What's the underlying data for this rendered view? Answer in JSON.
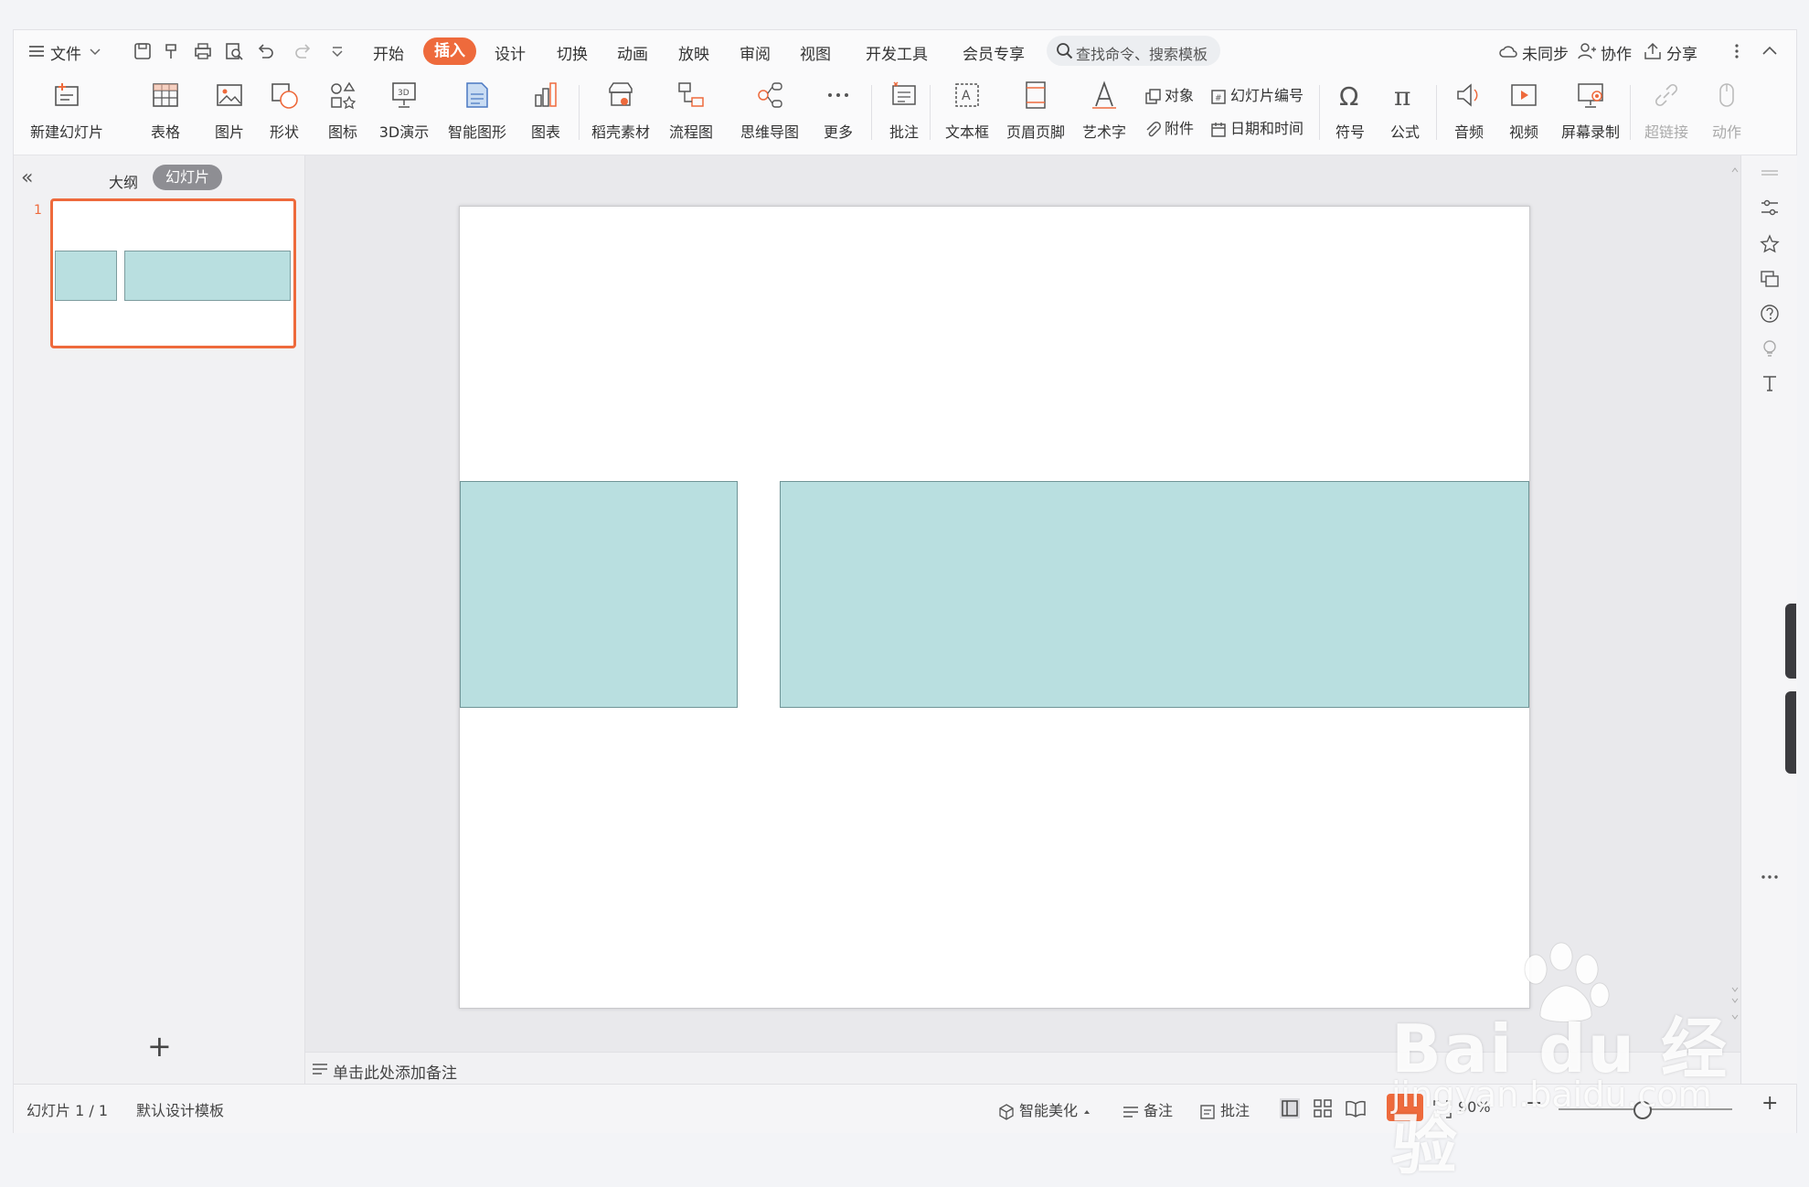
{
  "menubar": {
    "file_label": "文件",
    "tabs": [
      "开始",
      "插入",
      "设计",
      "切换",
      "动画",
      "放映",
      "审阅",
      "视图",
      "开发工具",
      "会员专享"
    ],
    "search_placeholder": "查找命令、搜索模板",
    "sync_label": "未同步",
    "collab_label": "协作",
    "share_label": "分享"
  },
  "ribbon": {
    "new_slide": "新建幻灯片",
    "table": "表格",
    "picture": "图片",
    "shape": "形状",
    "icon": "图标",
    "demo3d": "3D演示",
    "smartart": "智能图形",
    "chart": "图表",
    "material": "稻壳素材",
    "flowchart": "流程图",
    "mindmap": "思维导图",
    "more": "更多",
    "comment": "批注",
    "textbox": "文本框",
    "header_footer": "页眉页脚",
    "wordart": "艺术字",
    "object": "对象",
    "attachment": "附件",
    "slide_number": "幻灯片编号",
    "datetime": "日期和时间",
    "symbol": "符号",
    "formula": "公式",
    "audio": "音频",
    "video": "视频",
    "screen_record": "屏幕录制",
    "hyperlink": "超链接",
    "action": "动作"
  },
  "leftpanel": {
    "collapse": "«",
    "outline_tab": "大纲",
    "slides_tab": "幻灯片",
    "slide_number": "1",
    "add": "+"
  },
  "notes": {
    "placeholder": "单击此处添加备注"
  },
  "statusbar": {
    "slide_info": "幻灯片 1 / 1",
    "template": "默认设计模板",
    "beautify": "智能美化",
    "notes": "备注",
    "comment": "批注",
    "zoom": "90%"
  },
  "watermark": {
    "brand": "Bai du 经验",
    "url": "jingyan.baidu.com"
  },
  "colors": {
    "accent": "#ee6a3c",
    "shape_fill": "#b9dfe0",
    "shape_border": "#6f9496"
  }
}
